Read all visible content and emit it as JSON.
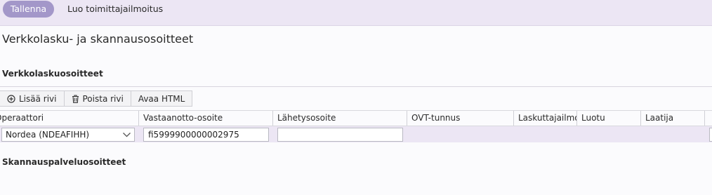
{
  "toolbar": {
    "save_label": "Tallenna",
    "create_supplier_label": "Luo toimittajailmoitus"
  },
  "page": {
    "title": "Verkkolasku- ja skannausosoitteet"
  },
  "einvoice": {
    "section_title": "Verkkolaskuosoitteet",
    "actions": {
      "add_row": "Lisää rivi",
      "delete_row": "Poista rivi",
      "open_html": "Avaa HTML"
    },
    "columns": [
      "Operaattori",
      "Vastaanotto-osoite",
      "Lähetysosoite",
      "OVT-tunnus",
      "Laskuttajailmoitus",
      "Luotu",
      "Laatija"
    ],
    "row": {
      "operator": "Nordea (NDEAFIHH)",
      "receive_address": "fi5999900000002975",
      "send_address": ""
    }
  },
  "scan": {
    "section_title": "Skannauspalveluosoitteet"
  }
}
